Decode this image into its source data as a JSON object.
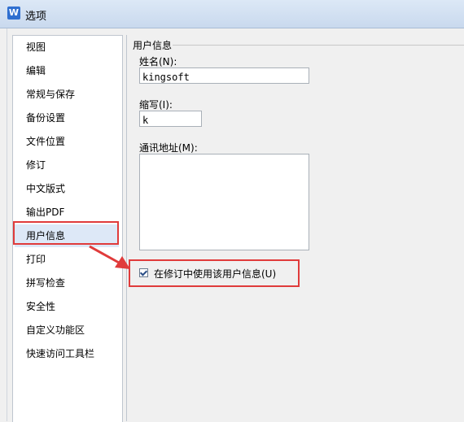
{
  "window": {
    "title": "选项",
    "icon": "w-app-icon",
    "icon_glyph": "W"
  },
  "sidebar": {
    "items": [
      {
        "label": "视图"
      },
      {
        "label": "编辑"
      },
      {
        "label": "常规与保存"
      },
      {
        "label": "备份设置"
      },
      {
        "label": "文件位置"
      },
      {
        "label": "修订"
      },
      {
        "label": "中文版式"
      },
      {
        "label": "输出PDF"
      },
      {
        "label": "用户信息",
        "selected": true
      },
      {
        "label": "打印"
      },
      {
        "label": "拼写检查"
      },
      {
        "label": "安全性"
      },
      {
        "label": "自定义功能区"
      },
      {
        "label": "快速访问工具栏"
      }
    ]
  },
  "user_info": {
    "group_title": "用户信息",
    "name_label": "姓名(N):",
    "name_value": "kingsoft",
    "initials_label": "缩写(I):",
    "initials_value": "k",
    "address_label": "通讯地址(M):",
    "address_value": "",
    "use_in_revision": {
      "label": "在修订中使用该用户信息(U)",
      "checked": true
    }
  },
  "annotations": {
    "highlight_color": "#e03b3b"
  }
}
